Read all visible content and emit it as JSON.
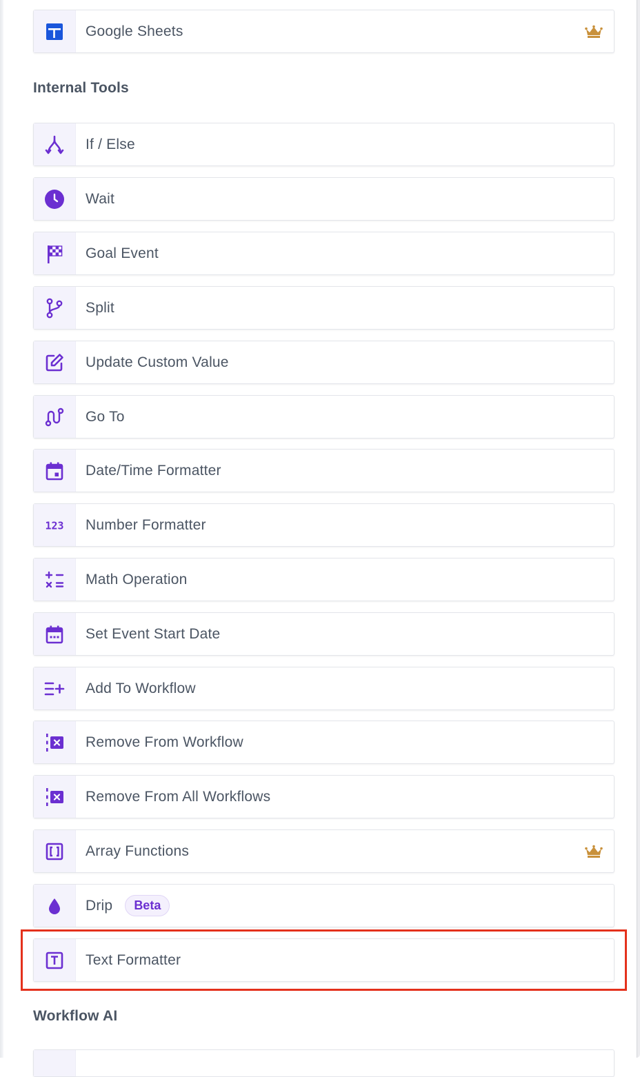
{
  "top_item": {
    "label": "Google Sheets",
    "icon": "google-sheets-icon",
    "premium": true
  },
  "sections": {
    "internal_tools": {
      "title": "Internal Tools"
    },
    "workflow_ai": {
      "title": "Workflow AI"
    }
  },
  "items": [
    {
      "label": "If / Else",
      "icon": "if-else-icon"
    },
    {
      "label": "Wait",
      "icon": "clock-icon"
    },
    {
      "label": "Goal Event",
      "icon": "checkered-flag-icon"
    },
    {
      "label": "Split",
      "icon": "branch-icon"
    },
    {
      "label": "Update Custom Value",
      "icon": "edit-icon"
    },
    {
      "label": "Go To",
      "icon": "route-icon"
    },
    {
      "label": "Date/Time Formatter",
      "icon": "calendar-icon"
    },
    {
      "label": "Number Formatter",
      "icon": "number-123-icon"
    },
    {
      "label": "Math Operation",
      "icon": "calculator-operators-icon"
    },
    {
      "label": "Set Event Start Date",
      "icon": "calendar-dots-icon"
    },
    {
      "label": "Add To Workflow",
      "icon": "list-add-icon"
    },
    {
      "label": "Remove From Workflow",
      "icon": "remove-from-workflow-icon"
    },
    {
      "label": "Remove From All Workflows",
      "icon": "remove-from-all-workflows-icon"
    },
    {
      "label": "Array Functions",
      "icon": "brackets-icon",
      "premium": true
    },
    {
      "label": "Drip",
      "icon": "drop-icon",
      "badge": "Beta"
    },
    {
      "label": "Text Formatter",
      "icon": "text-box-icon",
      "highlighted": true
    }
  ],
  "colors": {
    "accent": "#6b2fd1",
    "google_sheets": "#1a56db",
    "crown": "#c9913b",
    "highlight_border": "#e4311c",
    "icon_bg": "#f4f3fc"
  }
}
